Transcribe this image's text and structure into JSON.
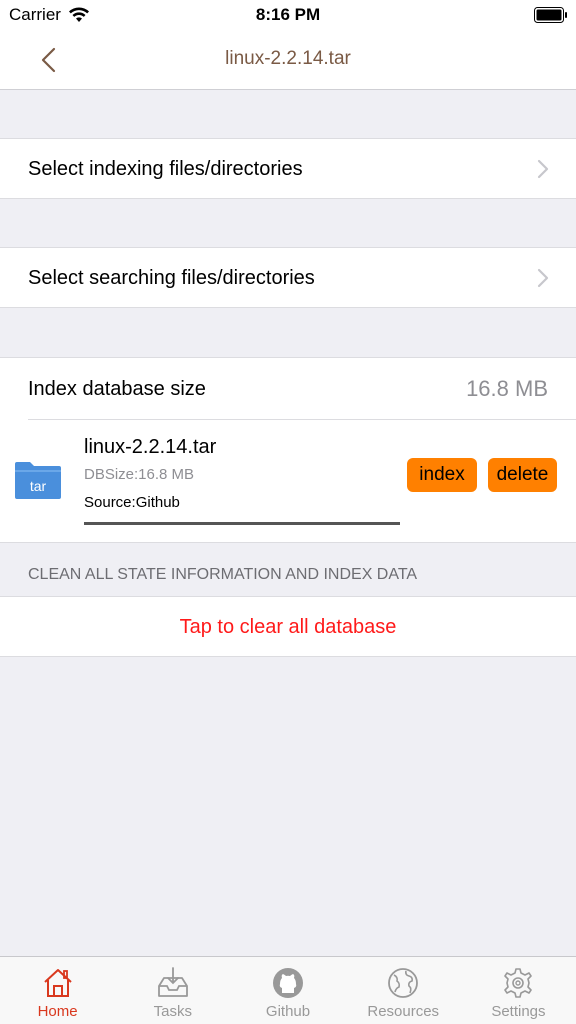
{
  "status_bar": {
    "carrier": "Carrier",
    "time": "8:16 PM"
  },
  "nav": {
    "title": "linux-2.2.14.tar",
    "back_icon": "chevron-left-icon"
  },
  "cells": {
    "index_label": "Select indexing files/directories",
    "search_label": "Select searching files/directories"
  },
  "database": {
    "size_label": "Index database size",
    "size_value": "16.8 MB",
    "item": {
      "folder_label": "tar",
      "name": "linux-2.2.14.tar",
      "dbsize": "DBSize:16.8 MB",
      "source": "Source:Github",
      "progress": 1.0,
      "index_button": "index",
      "delete_button": "delete"
    }
  },
  "clean": {
    "section_header": "CLEAN ALL STATE INFORMATION AND INDEX DATA",
    "clear_label": "Tap to clear all database"
  },
  "tabs": [
    {
      "label": "Home",
      "icon": "home-icon",
      "active": true
    },
    {
      "label": "Tasks",
      "icon": "inbox-download-icon",
      "active": false
    },
    {
      "label": "Github",
      "icon": "github-icon",
      "active": false
    },
    {
      "label": "Resources",
      "icon": "globe-icon",
      "active": false
    },
    {
      "label": "Settings",
      "icon": "gear-icon",
      "active": false
    }
  ],
  "colors": {
    "accent": "#ff8000",
    "active_tab": "#d9381e",
    "destructive": "#ff1a1a",
    "title": "#7a5a45",
    "folder": "#4a8fdc"
  }
}
